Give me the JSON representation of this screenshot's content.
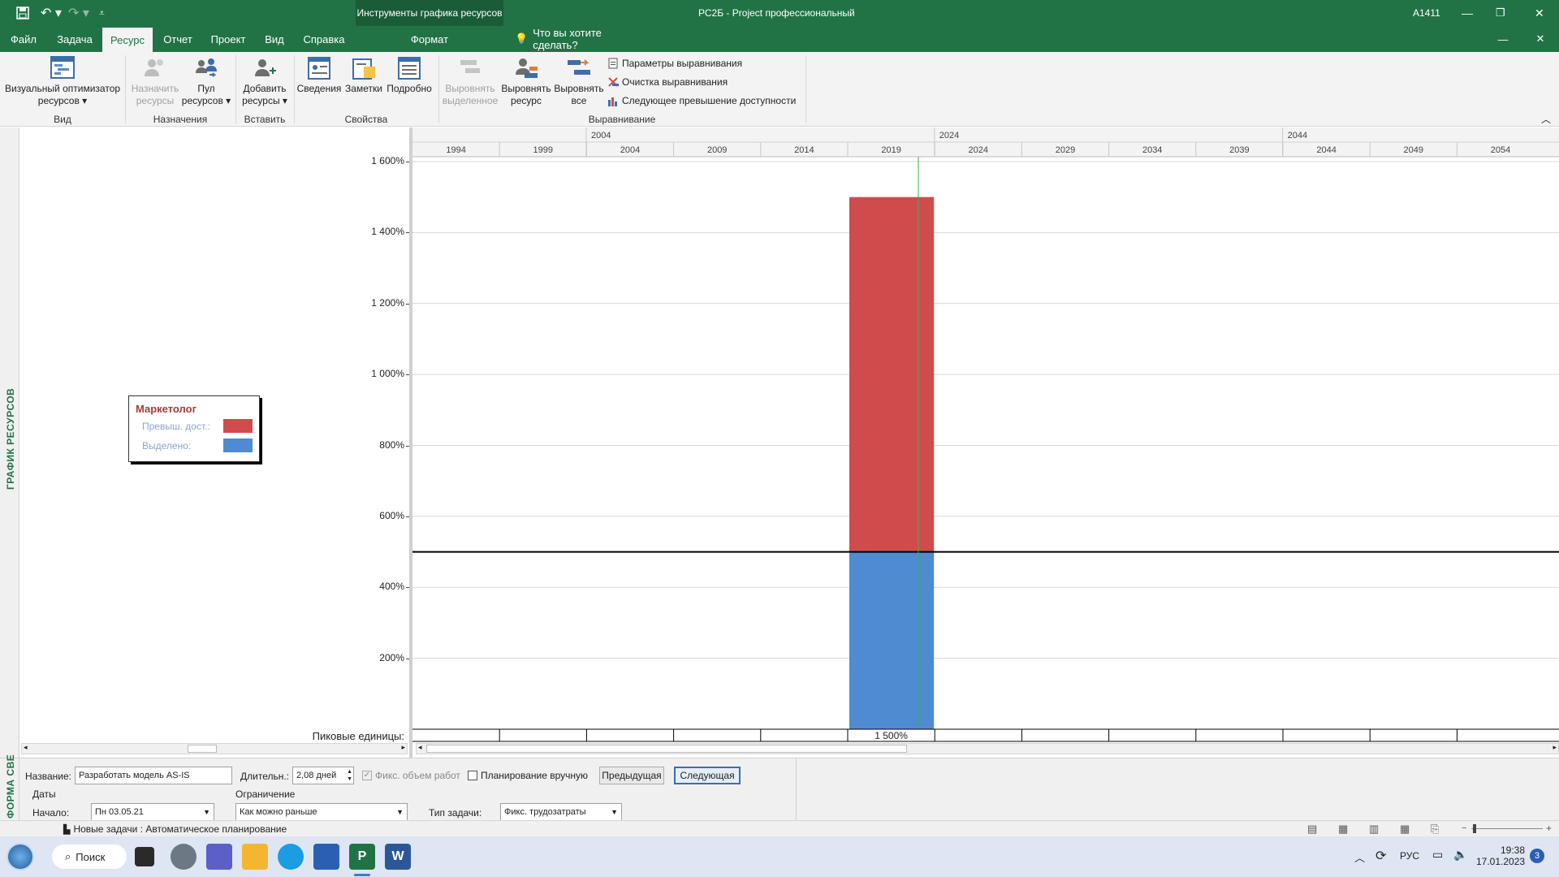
{
  "window": {
    "project_name": "РС2Б",
    "title_sep": " - ",
    "app_name": "Project профессиональный",
    "context_tools": "Инструменты графика ресурсов",
    "user": "А1411"
  },
  "tabs": [
    "Файл",
    "Задача",
    "Ресурс",
    "Отчет",
    "Проект",
    "Вид",
    "Справка",
    "Формат"
  ],
  "active_tab": "Ресурс",
  "tell_me": "Что вы хотите сделать?",
  "ribbon": {
    "visual_optimizer": [
      "Визуальный оптимизатор",
      "ресурсов ▾"
    ],
    "assign": [
      "Назначить",
      "ресурсы"
    ],
    "pool": [
      "Пул",
      "ресурсов ▾"
    ],
    "add": [
      "Добавить",
      "ресурсы ▾"
    ],
    "info": "Сведения",
    "notes": "Заметки",
    "details": "Подробно",
    "level_selection": [
      "Выровнять",
      "выделенное"
    ],
    "level_resource": [
      "Выровнять",
      "ресурс"
    ],
    "level_all": [
      "Выровнять",
      "все"
    ],
    "leveling_options": "Параметры выравнивания",
    "clear_leveling": "Очистка выравнивания",
    "next_overallocation": "Следующее превышение доступности",
    "groups": {
      "view": "Вид",
      "assignments": "Назначения",
      "insert": "Вставить",
      "properties": "Свойства",
      "leveling": "Выравнивание"
    }
  },
  "side_label": "ГРАФИК РЕСУРСОВ",
  "form_side_label": "ФОРМА СВЕ",
  "legend": {
    "title": "Маркетолог",
    "overallocated": "Превыш. дост.:",
    "allocated": "Выделено:",
    "overallocated_color": "#d04c4c",
    "allocated_color": "#4f8bd0"
  },
  "peak_label": "Пиковые единицы:",
  "chart_data": {
    "type": "bar",
    "stacked": true,
    "y_ticks": [
      "1 600%",
      "1 400%",
      "1 200%",
      "1 000%",
      "800%",
      "600%",
      "400%",
      "200%"
    ],
    "ylim": [
      0,
      1600
    ],
    "availability": 500,
    "timescale_top": [
      "2004",
      "2024",
      "2044"
    ],
    "timescale_bottom": [
      "1994",
      "1999",
      "2004",
      "2009",
      "2014",
      "2019",
      "2024",
      "2029",
      "2034",
      "2039",
      "2044",
      "2049",
      "2054"
    ],
    "bar_period": "2019",
    "series": [
      {
        "name": "Выделено:",
        "value": 500,
        "color": "#4f8bd0"
      },
      {
        "name": "Превыш. дост.:",
        "value": 1000,
        "color": "#d04c4c"
      }
    ],
    "peak_values": [
      "",
      "",
      "",
      "",
      "",
      "1 500%",
      "",
      "",
      "",
      "",
      "",
      "",
      ""
    ]
  },
  "form": {
    "name_label": "Название:",
    "name_value": "Разработать модель AS-IS",
    "duration_label": "Длительн.:",
    "duration_value": "2,08 дней",
    "fixed_work": "Фикс. объем работ",
    "manual": "Планирование вручную",
    "prev": "Предыдущая",
    "next": "Следующая",
    "dates": "Даты",
    "start_label": "Начало:",
    "start_value": "Пн 03.05.21",
    "constraint_label": "Ограничение",
    "constraint_value": "Как можно раньше",
    "task_type_label": "Тип задачи:",
    "task_type_value": "Фикс. трудозатраты"
  },
  "status": {
    "new_tasks": "Новые задачи : Автоматическое планирование"
  },
  "taskbar": {
    "search": "Поиск",
    "lang": "РУС",
    "time": "19:38",
    "date": "17.01.2023",
    "badge": "3"
  }
}
